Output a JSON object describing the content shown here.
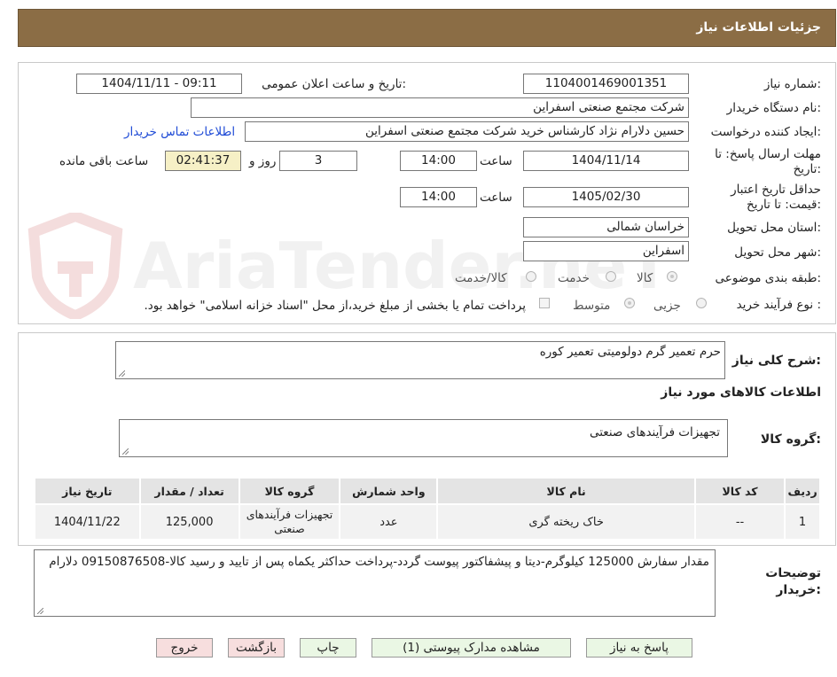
{
  "header": {
    "title": "جزئیات اطلاعات نیاز"
  },
  "watermark": {
    "text": "AriaTender.neT"
  },
  "form": {
    "need_number_label": "شماره نیاز:",
    "need_number": "1104001469001351",
    "announce_label": "تاریخ و ساعت اعلان عمومی:",
    "announce_value": "1404/11/11 - 09:11",
    "buyer_org_label": "نام دستگاه خریدار:",
    "buyer_org": "شرکت مجتمع صنعتی اسفراین",
    "requester_label": "ایجاد کننده درخواست:",
    "requester": "حسین دلارام نژاد کارشناس خرید شرکت مجتمع صنعتی اسفراین",
    "contact_link": "اطلاعات تماس خریدار",
    "deadline_label_1": "مهلت ارسال پاسخ: تا",
    "deadline_label_2": "تاریخ:",
    "deadline_date": "1404/11/14",
    "time_label": "ساعت",
    "deadline_time": "14:00",
    "days_value": "3",
    "days_label": "روز و",
    "remaining_time": "02:41:37",
    "remaining_label": "ساعت باقی مانده",
    "validity_label_1": "حداقل تاریخ اعتبار",
    "validity_label_2": "قیمت: تا تاریخ:",
    "validity_date": "1405/02/30",
    "validity_time": "14:00",
    "province_label": "استان محل تحویل:",
    "province": "خراسان شمالی",
    "city_label": "شهر محل تحویل:",
    "city": "اسفراین",
    "category_label": "طبقه بندی موضوعی:",
    "category_options": [
      "کالا",
      "خدمت",
      "کالا/خدمت"
    ],
    "process_label": "نوع فرآیند خرید :",
    "process_options": [
      "جزیی",
      "متوسط"
    ],
    "payment_note": "پرداخت تمام یا بخشی از مبلغ خرید،از محل \"اسناد خزانه اسلامی\" خواهد بود."
  },
  "description": {
    "general_label": "شرح کلی نیاز:",
    "general_value": "حرم تعمیر گرم دولومیتی تعمیر کوره",
    "goods_info_title": "اطلاعات کالاهای مورد نیاز",
    "group_label": "گروه کالا:",
    "group_value": "تجهیزات فرآیندهای صنعتی"
  },
  "table": {
    "headers": [
      "ردیف",
      "کد کالا",
      "نام کالا",
      "واحد شمارش",
      "گروه کالا",
      "تعداد / مقدار",
      "تاریخ نیاز"
    ],
    "rows": [
      [
        "1",
        "--",
        "خاک ریخته گری",
        "عدد",
        "تجهیزات فرآیندهای صنعتی",
        "125,000",
        "1404/11/22"
      ]
    ]
  },
  "buyer_notes": {
    "label_1": "توضیحات",
    "label_2": "خریدار:",
    "value": "مقدار سفارش 125000 کیلوگرم-دیتا و پیشفاکتور پیوست گردد-پرداخت حداکثر یکماه پس از تایید و رسید کالا-09150876508 دلارام"
  },
  "buttons": {
    "reply": "پاسخ به نیاز",
    "attachments": "مشاهده مدارک پیوستی (1)",
    "print": "چاپ",
    "back": "بازگشت",
    "exit": "خروج"
  },
  "colors": {
    "header_bg": "#8b6d45",
    "accent_link": "#1f4bd6",
    "remaining_bg": "#f6f0c6",
    "button_green": "#eaf7e4",
    "button_pink": "#f7dede"
  }
}
